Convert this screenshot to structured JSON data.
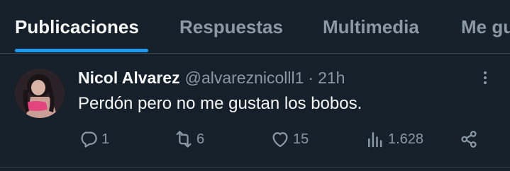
{
  "tabs": [
    {
      "label": "Publicaciones",
      "active": true
    },
    {
      "label": "Respuestas",
      "active": false
    },
    {
      "label": "Multimedia",
      "active": false
    },
    {
      "label": "Me gustan",
      "active": false
    }
  ],
  "post": {
    "author_name": "Nicol Alvarez",
    "handle": "@alvareznicolll1",
    "separator": "·",
    "time": "21h",
    "text": "Perdón pero no me gustan los bobos.",
    "actions": {
      "replies": "1",
      "reposts": "6",
      "likes": "15",
      "views": "1.628"
    }
  },
  "colors": {
    "background": "#15202b",
    "accent": "#1d9bf0",
    "muted": "#8b98a5",
    "divider": "#38444d"
  },
  "icons": [
    "reply-icon",
    "repost-icon",
    "like-icon",
    "views-icon",
    "share-icon",
    "more-icon"
  ]
}
